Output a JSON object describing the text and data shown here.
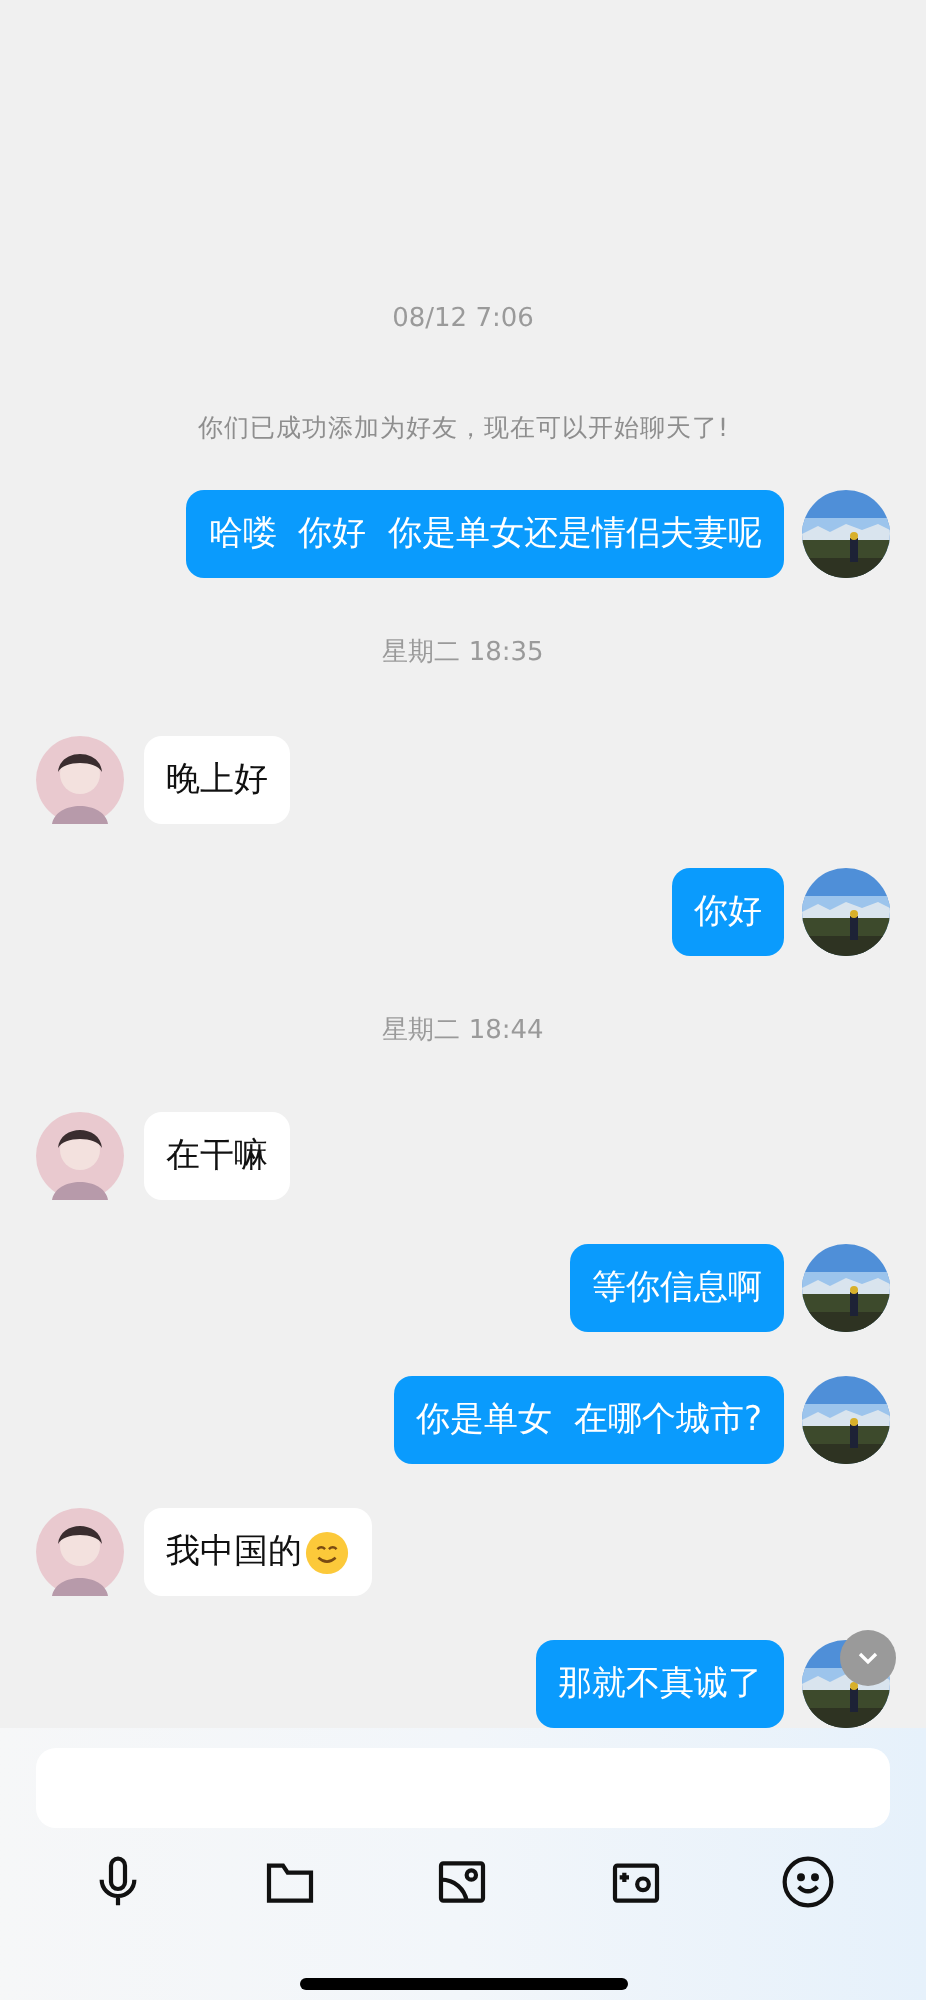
{
  "messages": [
    {
      "kind": "time",
      "text": "08/12 7:06"
    },
    {
      "kind": "system",
      "text": "你们已成功添加为好友，现在可以开始聊天了!"
    },
    {
      "kind": "sent",
      "text": "哈喽  你好  你是单女还是情侣夫妻呢"
    },
    {
      "kind": "time",
      "text": "星期二 18:35"
    },
    {
      "kind": "received",
      "text": "晚上好"
    },
    {
      "kind": "sent",
      "text": "你好"
    },
    {
      "kind": "time",
      "text": "星期二 18:44"
    },
    {
      "kind": "received",
      "text": "在干嘛"
    },
    {
      "kind": "sent",
      "text": "等你信息啊"
    },
    {
      "kind": "sent",
      "text": "你是单女  在哪个城市?"
    },
    {
      "kind": "received",
      "text": "我中国的",
      "emoji": true
    },
    {
      "kind": "sent",
      "text": "那就不真诚了"
    }
  ]
}
